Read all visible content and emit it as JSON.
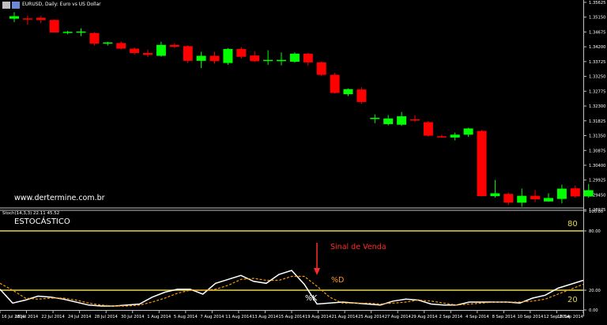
{
  "chart_data": [
    {
      "type": "candlestick",
      "title": "EURUSD, Daily: Euro vs US Dollar",
      "watermark": "www.dertermine.com.br",
      "colors": {
        "bull": "#00ff00",
        "bear": "#ff0000",
        "background": "#000000",
        "axis": "#c0c0c0"
      },
      "ylim": [
        1.2903,
        1.357
      ],
      "price_ticks": [
        "1.35625",
        "1.35150",
        "1.34675",
        "1.34200",
        "1.33725",
        "1.33250",
        "1.32775",
        "1.32300",
        "1.31825",
        "1.31350",
        "1.30875",
        "1.30400",
        "1.29925",
        "1.29450",
        "1.28975"
      ],
      "candles": [
        {
          "o": 1.351,
          "h": 1.3531,
          "l": 1.3499,
          "c": 1.3518
        },
        {
          "o": 1.3511,
          "h": 1.352,
          "l": 1.3491,
          "c": 1.3508
        },
        {
          "o": 1.3513,
          "h": 1.3519,
          "l": 1.3496,
          "c": 1.3506
        },
        {
          "o": 1.3506,
          "h": 1.3508,
          "l": 1.3466,
          "c": 1.3466
        },
        {
          "o": 1.3466,
          "h": 1.3471,
          "l": 1.346,
          "c": 1.3468
        },
        {
          "o": 1.3466,
          "h": 1.3479,
          "l": 1.3454,
          "c": 1.3469
        },
        {
          "o": 1.3464,
          "h": 1.3467,
          "l": 1.3424,
          "c": 1.343
        },
        {
          "o": 1.343,
          "h": 1.3436,
          "l": 1.3424,
          "c": 1.3434
        },
        {
          "o": 1.3432,
          "h": 1.3437,
          "l": 1.3411,
          "c": 1.3414
        },
        {
          "o": 1.3414,
          "h": 1.3418,
          "l": 1.3395,
          "c": 1.34
        },
        {
          "o": 1.34,
          "h": 1.3411,
          "l": 1.3387,
          "c": 1.3394
        },
        {
          "o": 1.3391,
          "h": 1.3436,
          "l": 1.3388,
          "c": 1.3426
        },
        {
          "o": 1.3426,
          "h": 1.3431,
          "l": 1.3416,
          "c": 1.342
        },
        {
          "o": 1.3422,
          "h": 1.3425,
          "l": 1.3368,
          "c": 1.3375
        },
        {
          "o": 1.3375,
          "h": 1.3404,
          "l": 1.3352,
          "c": 1.3391
        },
        {
          "o": 1.3391,
          "h": 1.3404,
          "l": 1.3366,
          "c": 1.3374
        },
        {
          "o": 1.3368,
          "h": 1.3416,
          "l": 1.3362,
          "c": 1.3413
        },
        {
          "o": 1.3413,
          "h": 1.3419,
          "l": 1.3382,
          "c": 1.3388
        },
        {
          "o": 1.3392,
          "h": 1.3406,
          "l": 1.3371,
          "c": 1.3374
        },
        {
          "o": 1.3378,
          "h": 1.3409,
          "l": 1.3362,
          "c": 1.3378
        },
        {
          "o": 1.3374,
          "h": 1.3402,
          "l": 1.336,
          "c": 1.3378
        },
        {
          "o": 1.3372,
          "h": 1.3402,
          "l": 1.3369,
          "c": 1.3398
        },
        {
          "o": 1.3398,
          "h": 1.34,
          "l": 1.336,
          "c": 1.337
        },
        {
          "o": 1.337,
          "h": 1.3373,
          "l": 1.3326,
          "c": 1.333
        },
        {
          "o": 1.333,
          "h": 1.3336,
          "l": 1.327,
          "c": 1.3272
        },
        {
          "o": 1.3268,
          "h": 1.3286,
          "l": 1.3262,
          "c": 1.3284
        },
        {
          "o": 1.3283,
          "h": 1.329,
          "l": 1.3237,
          "c": 1.3243
        },
        {
          "o": 1.3192,
          "h": 1.3203,
          "l": 1.3175,
          "c": 1.3192
        },
        {
          "o": 1.3172,
          "h": 1.3201,
          "l": 1.3168,
          "c": 1.319
        },
        {
          "o": 1.317,
          "h": 1.3211,
          "l": 1.3166,
          "c": 1.3197
        },
        {
          "o": 1.3187,
          "h": 1.32,
          "l": 1.318,
          "c": 1.3184
        },
        {
          "o": 1.3178,
          "h": 1.3182,
          "l": 1.3131,
          "c": 1.3135
        },
        {
          "o": 1.3133,
          "h": 1.3138,
          "l": 1.3128,
          "c": 1.313
        },
        {
          "o": 1.3129,
          "h": 1.3145,
          "l": 1.312,
          "c": 1.3138
        },
        {
          "o": 1.3138,
          "h": 1.316,
          "l": 1.3131,
          "c": 1.3158
        },
        {
          "o": 1.315,
          "h": 1.3153,
          "l": 1.294,
          "c": 1.2941
        },
        {
          "o": 1.2941,
          "h": 1.2993,
          "l": 1.2936,
          "c": 1.295
        },
        {
          "o": 1.2948,
          "h": 1.2952,
          "l": 1.2913,
          "c": 1.292
        },
        {
          "o": 1.292,
          "h": 1.2965,
          "l": 1.2907,
          "c": 1.2942
        },
        {
          "o": 1.2942,
          "h": 1.296,
          "l": 1.2923,
          "c": 1.2931
        },
        {
          "o": 1.2924,
          "h": 1.295,
          "l": 1.2923,
          "c": 1.2935
        },
        {
          "o": 1.2932,
          "h": 1.2978,
          "l": 1.2918,
          "c": 1.2965
        },
        {
          "o": 1.2966,
          "h": 1.2975,
          "l": 1.2936,
          "c": 1.294
        },
        {
          "o": 1.294,
          "h": 1.298,
          "l": 1.2936,
          "c": 1.296
        }
      ]
    },
    {
      "type": "line",
      "indicator_label": "Stoch(14,3,3) 22.11 45.52",
      "panel_title": "ESTOCÁSTICO",
      "ylim": [
        0,
        100
      ],
      "right_ticks": [
        "100.00",
        "80.00",
        "20.00",
        "0.00"
      ],
      "levels": [
        {
          "value": 80,
          "label": "80"
        },
        {
          "value": 20,
          "label": "20"
        }
      ],
      "series": [
        {
          "name": "%K",
          "color": "#ffffff",
          "values": [
            21,
            7,
            10,
            14,
            13,
            11,
            8,
            5,
            4,
            4,
            5,
            6,
            13,
            18,
            21,
            21,
            16,
            27,
            31,
            35,
            29,
            27,
            36,
            40,
            26,
            6,
            7,
            8,
            7,
            6,
            5,
            9,
            11,
            10,
            6,
            5,
            5,
            8,
            8,
            8,
            8,
            7,
            12,
            15,
            22,
            26,
            30
          ]
        },
        {
          "name": "%D",
          "color": "#ff9900",
          "values": [
            27,
            20,
            12,
            11,
            12,
            12,
            10,
            7,
            5,
            4,
            4,
            5,
            8,
            12,
            17,
            20,
            20,
            21,
            25,
            31,
            32,
            30,
            30,
            34,
            34,
            24,
            13,
            7,
            7,
            7,
            6,
            7,
            8,
            10,
            9,
            7,
            5,
            6,
            7,
            8,
            8,
            8,
            9,
            11,
            16,
            21,
            26
          ]
        }
      ],
      "annotations": {
        "signal": "Sinal de Venda",
        "k_label": "%K",
        "d_label": "%D"
      }
    }
  ],
  "x_axis_labels": [
    "16 Jul 2014",
    "18 Jul 2014",
    "22 Jul 2014",
    "24 Jul 2014",
    "28 Jul 2014",
    "30 Jul 2014",
    "1 Aug 2014",
    "5 Aug 2014",
    "7 Aug 2014",
    "11 Aug 2014",
    "13 Aug 2014",
    "15 Aug 2014",
    "19 Aug 2014",
    "21 Aug 2014",
    "25 Aug 2014",
    "27 Aug 2014",
    "29 Aug 2014",
    "2 Sep 2014",
    "4 Sep 2014",
    "8 Sep 2014",
    "10 Sep 2014",
    "12 Sep 2014",
    "16 Sep 2014"
  ]
}
